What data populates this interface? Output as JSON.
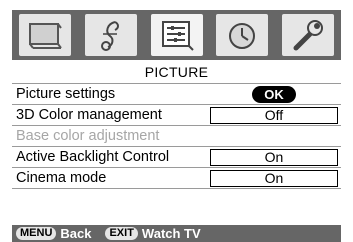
{
  "icons": [
    {
      "name": "tv-screen-icon"
    },
    {
      "name": "music-note-icon"
    },
    {
      "name": "picture-settings-icon"
    },
    {
      "name": "clock-icon"
    },
    {
      "name": "wrench-icon"
    }
  ],
  "screen": {
    "title": "PICTURE"
  },
  "menu": {
    "items": [
      {
        "label": "Picture settings",
        "value": "OK"
      },
      {
        "label": "3D Color management",
        "value": "Off"
      },
      {
        "label": "Base color adjustment",
        "value": ""
      },
      {
        "label": "Active Backlight Control",
        "value": "On"
      },
      {
        "label": "Cinema mode",
        "value": "On"
      }
    ]
  },
  "footer": {
    "menu_key": "MENU",
    "menu_action": "Back",
    "exit_key": "EXIT",
    "exit_action": "Watch TV"
  },
  "colors": {
    "bar": "#666666",
    "tile": "#e6e6e6",
    "disabled_text": "#a6a6a6"
  }
}
